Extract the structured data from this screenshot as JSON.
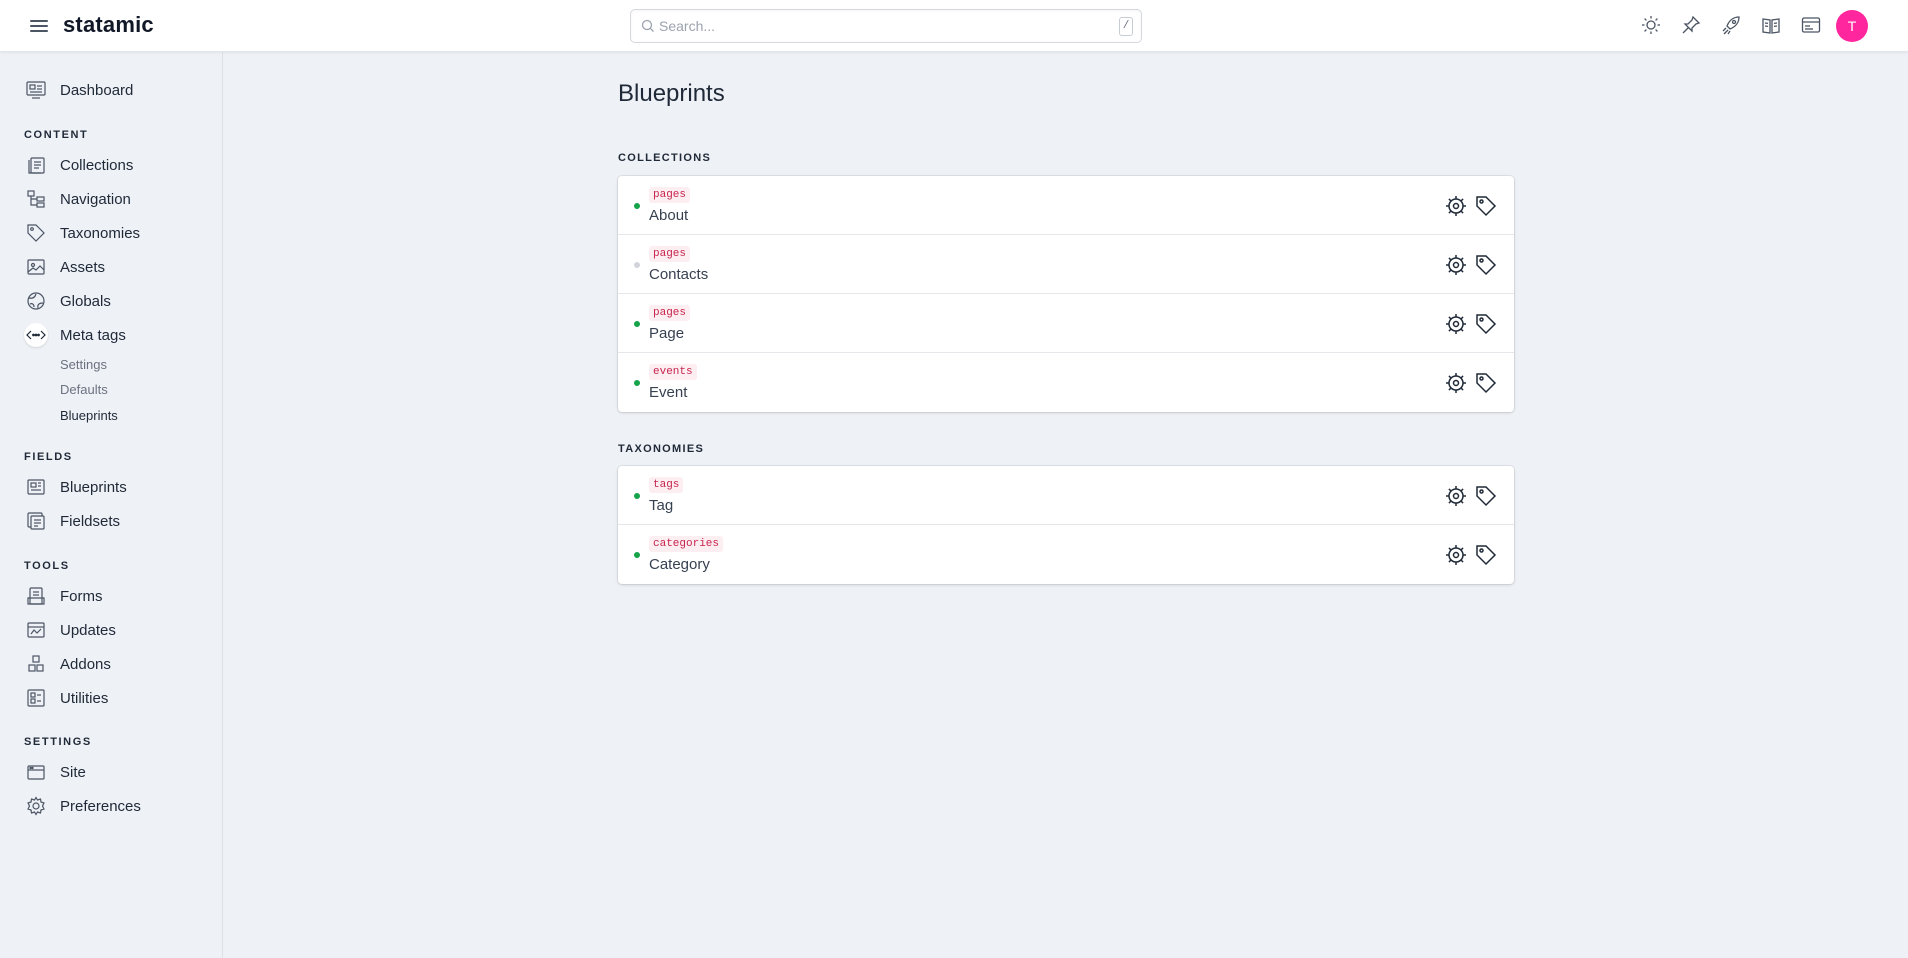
{
  "app": {
    "logo": "statamic"
  },
  "header": {
    "search_placeholder": "Search...",
    "search_shortcut": "/",
    "icons": [
      "sun-icon",
      "pin-icon",
      "rocket-icon",
      "book-icon",
      "site-icon"
    ],
    "avatar_initial": "T",
    "avatar_color": "#ff269e"
  },
  "sidebar": {
    "dashboard": "Dashboard",
    "content_title": "CONTENT",
    "content": [
      "Collections",
      "Navigation",
      "Taxonomies",
      "Assets",
      "Globals",
      "Meta tags"
    ],
    "meta_sub": [
      "Settings",
      "Defaults",
      "Blueprints"
    ],
    "fields_title": "FIELDS",
    "fields": [
      "Blueprints",
      "Fieldsets"
    ],
    "tools_title": "TOOLS",
    "tools": [
      "Forms",
      "Updates",
      "Addons",
      "Utilities"
    ],
    "settings_title": "SETTINGS",
    "settings": [
      "Site",
      "Preferences"
    ]
  },
  "main": {
    "title": "Blueprints",
    "collections_label": "COLLECTIONS",
    "collections": [
      {
        "handle": "pages",
        "title": "About",
        "status": "published"
      },
      {
        "handle": "pages",
        "title": "Contacts",
        "status": "draft"
      },
      {
        "handle": "pages",
        "title": "Page",
        "status": "published"
      },
      {
        "handle": "events",
        "title": "Event",
        "status": "published"
      }
    ],
    "taxonomies_label": "TAXONOMIES",
    "taxonomies": [
      {
        "handle": "tags",
        "title": "Tag",
        "status": "published"
      },
      {
        "handle": "categories",
        "title": "Category",
        "status": "published"
      }
    ]
  },
  "colors": {
    "published": "#16a34a",
    "draft": "#d1d5db",
    "handle_text": "#c7254e"
  }
}
